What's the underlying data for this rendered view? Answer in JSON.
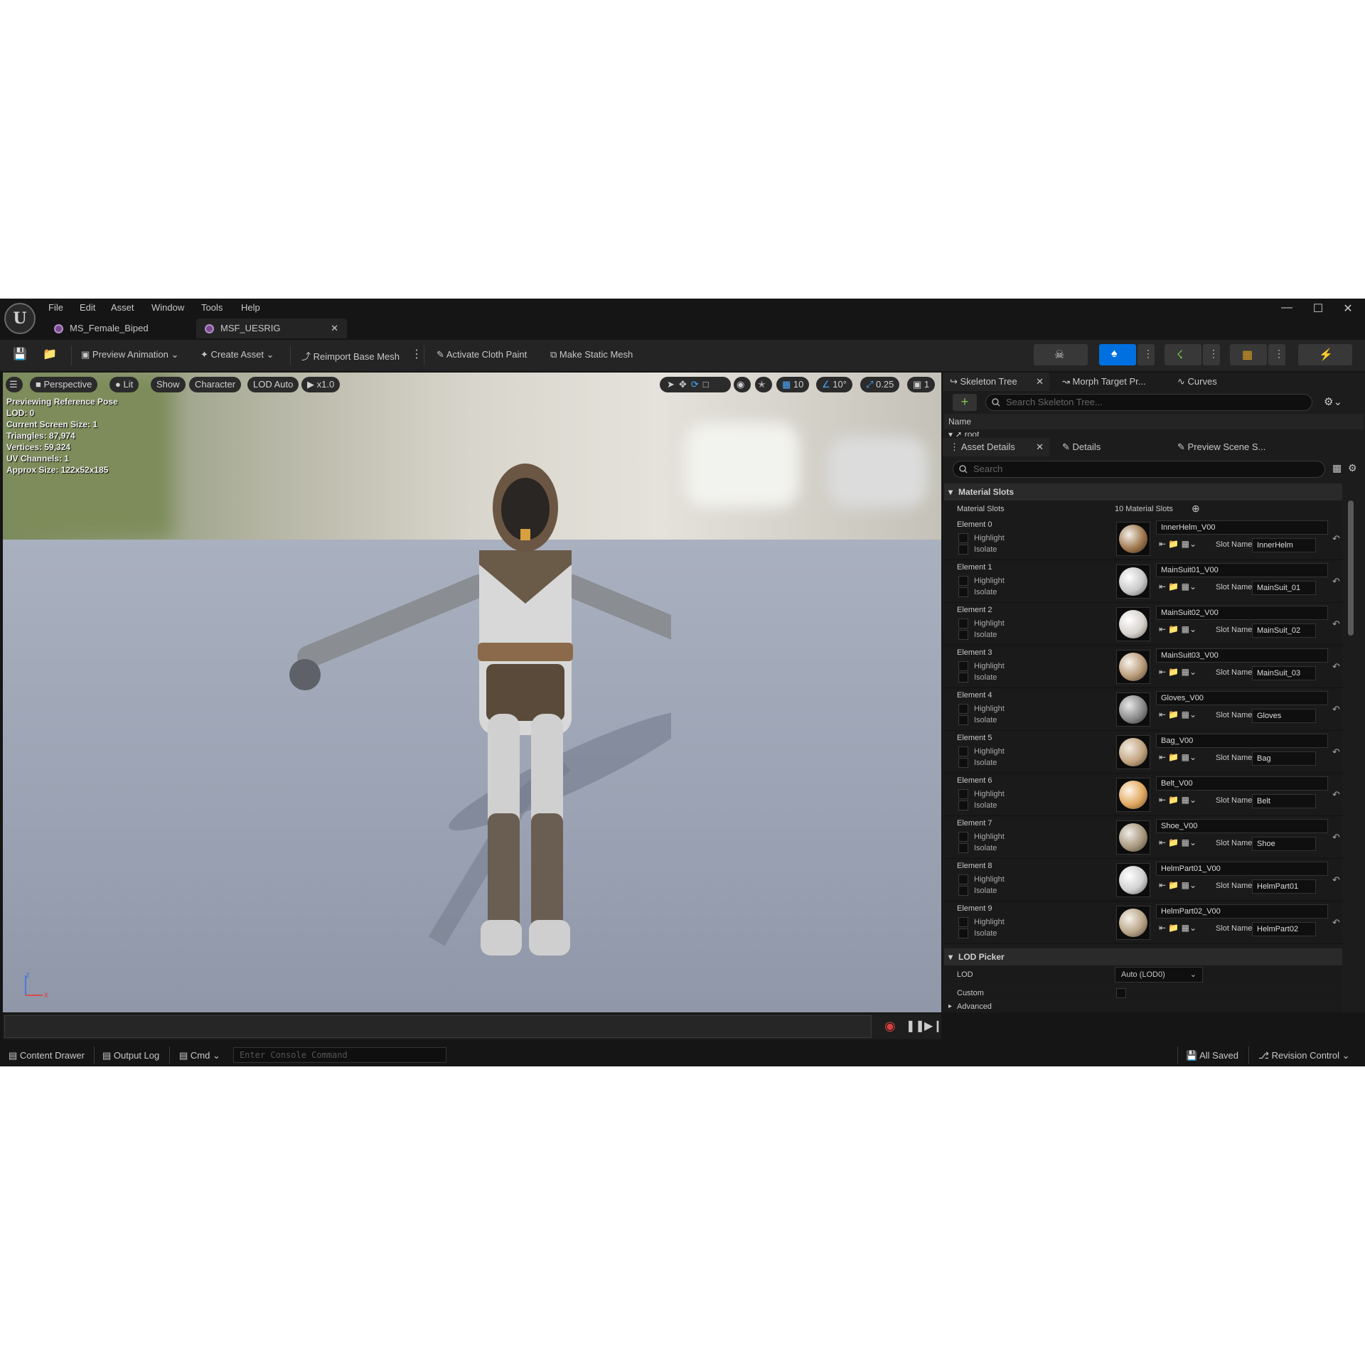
{
  "menu": [
    "File",
    "Edit",
    "Asset",
    "Window",
    "Tools",
    "Help"
  ],
  "tabs": [
    {
      "label": "MS_Female_Biped",
      "active": false
    },
    {
      "label": "MSF_UESRIG",
      "active": true
    }
  ],
  "toolbar": {
    "preview_animation": "Preview Animation",
    "create_asset": "Create Asset",
    "reimport": "Reimport Base Mesh",
    "cloth_paint": "Activate Cloth Paint",
    "static_mesh": "Make Static Mesh"
  },
  "viewport": {
    "perspective": "Perspective",
    "lit": "Lit",
    "show": "Show",
    "character": "Character",
    "lod": "LOD Auto",
    "speed": "x1.0",
    "grid_snap": "10",
    "angle_snap": "10°",
    "scale_snap": "0.25",
    "camera_speed": "1",
    "stats": [
      "Previewing Reference Pose",
      "LOD: 0",
      "Current Screen Size: 1",
      "Triangles: 87,974",
      "Vertices: 59,324",
      "UV Channels: 1",
      "Approx Size: 122x52x185"
    ],
    "axis_z": "z",
    "axis_x": "x"
  },
  "skeleton_panel": {
    "tabs": [
      "Skeleton Tree",
      "Morph Target Pr...",
      "Curves"
    ],
    "search_placeholder": "Search Skeleton Tree...",
    "col_name": "Name",
    "root": "root"
  },
  "details_panel": {
    "tabs": [
      "Asset Details",
      "Details",
      "Preview Scene S..."
    ],
    "search_placeholder": "Search",
    "material_slots_header": "Material Slots",
    "material_slots_label": "Material Slots",
    "material_slots_count": "10 Material Slots",
    "highlight": "Highlight",
    "isolate": "Isolate",
    "slot_name_label": "Slot Name",
    "elements": [
      {
        "label": "Element 0",
        "material": "InnerHelm_V00",
        "slot": "InnerHelm"
      },
      {
        "label": "Element 1",
        "material": "MainSuit01_V00",
        "slot": "MainSuit_01"
      },
      {
        "label": "Element 2",
        "material": "MainSuit02_V00",
        "slot": "MainSuit_02"
      },
      {
        "label": "Element 3",
        "material": "MainSuit03_V00",
        "slot": "MainSuit_03"
      },
      {
        "label": "Element 4",
        "material": "Gloves_V00",
        "slot": "Gloves"
      },
      {
        "label": "Element 5",
        "material": "Bag_V00",
        "slot": "Bag"
      },
      {
        "label": "Element 6",
        "material": "Belt_V00",
        "slot": "Belt"
      },
      {
        "label": "Element 7",
        "material": "Shoe_V00",
        "slot": "Shoe"
      },
      {
        "label": "Element 8",
        "material": "HelmPart01_V00",
        "slot": "HelmPart01"
      },
      {
        "label": "Element 9",
        "material": "HelmPart02_V00",
        "slot": "HelmPart02"
      }
    ],
    "lod_picker_header": "LOD Picker",
    "lod_label": "LOD",
    "lod_value": "Auto (LOD0)",
    "custom_label": "Custom",
    "advanced_label": "Advanced"
  },
  "statusbar": {
    "content_drawer": "Content Drawer",
    "output_log": "Output Log",
    "cmd": "Cmd",
    "console_placeholder": "Enter Console Command",
    "all_saved": "All Saved",
    "revision_control": "Revision Control"
  },
  "colors": {
    "accent": "#0070e0",
    "bg": "#151515",
    "panel": "#242424"
  }
}
